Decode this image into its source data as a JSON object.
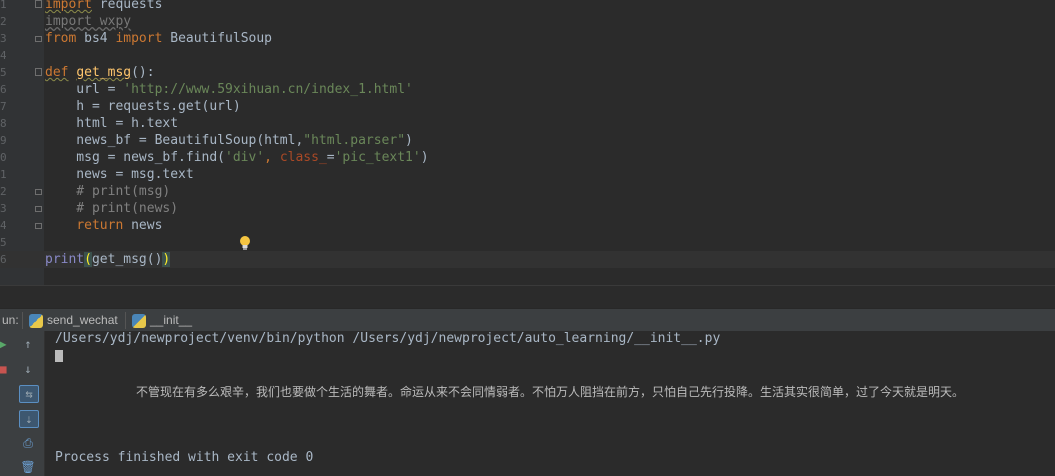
{
  "editor": {
    "line_numbers": [
      "1",
      "2",
      "3",
      "4",
      "5",
      "6",
      "7",
      "8",
      "9",
      "0",
      "1",
      "2",
      "3",
      "4",
      "5",
      "6"
    ],
    "lines": [
      {
        "kind": "import1",
        "t1": "import",
        "t2": " requests"
      },
      {
        "kind": "import2",
        "t1": "import wxpy"
      },
      {
        "kind": "from",
        "t1": "from",
        "t2": " bs4 ",
        "t3": "import",
        "t4": " BeautifulSoup"
      },
      {
        "kind": "blank"
      },
      {
        "kind": "def",
        "t1": "def",
        "t2": "get_msg",
        "t3": "():"
      },
      {
        "kind": "url",
        "t1": "    url = ",
        "t2": "'http://www.59xihuan.cn/index_1.html'"
      },
      {
        "kind": "plain",
        "t1": "    h = requests.get(url)"
      },
      {
        "kind": "plain",
        "t1": "    html = h.text"
      },
      {
        "kind": "bf",
        "t1": "    news_bf = BeautifulSoup(html,",
        "t2": "\"html.parser\"",
        "t3": ")"
      },
      {
        "kind": "find",
        "t1": "    msg = news_bf.find(",
        "t2": "'div'",
        "t3": ", ",
        "t4": "class_",
        "t5": "=",
        "t6": "'pic_text1'",
        "t7": ")"
      },
      {
        "kind": "plain",
        "t1": "    news = msg.text"
      },
      {
        "kind": "comment",
        "t1": "    # print(msg)"
      },
      {
        "kind": "comment",
        "t1": "    # print(news)"
      },
      {
        "kind": "return",
        "t1": "    ",
        "t2": "return",
        "t3": " news"
      },
      {
        "kind": "blank"
      },
      {
        "kind": "print",
        "t1": "print",
        "t2": "(",
        "t3": "get_msg()",
        "t4": ")"
      }
    ]
  },
  "run_panel": {
    "label": "un:",
    "tabs": [
      {
        "label": "send_wechat"
      },
      {
        "label": "__init__"
      }
    ]
  },
  "console": {
    "command": "/Users/ydj/newproject/venv/bin/python /Users/ydj/newproject/auto_learning/__init__.py",
    "output": "不管现在有多么艰辛，我们也要做个生活的舞者。命运从来不会同情弱者。不怕万人阻挡在前方，只怕自己先行投降。生活其实很简单，过了今天就是明天。",
    "exit": "Process finished with exit code 0"
  },
  "colors": {
    "background": "#2b2b2b",
    "keyword": "#cc7832",
    "string": "#6a8759",
    "function": "#ffc66d",
    "comment": "#808080"
  },
  "icons": [
    "run-icon",
    "stop-icon",
    "up-arrow-icon",
    "down-arrow-icon",
    "soft-wrap-icon",
    "scroll-to-end-icon",
    "print-icon",
    "trash-icon",
    "lightbulb-icon",
    "python-file-icon"
  ]
}
